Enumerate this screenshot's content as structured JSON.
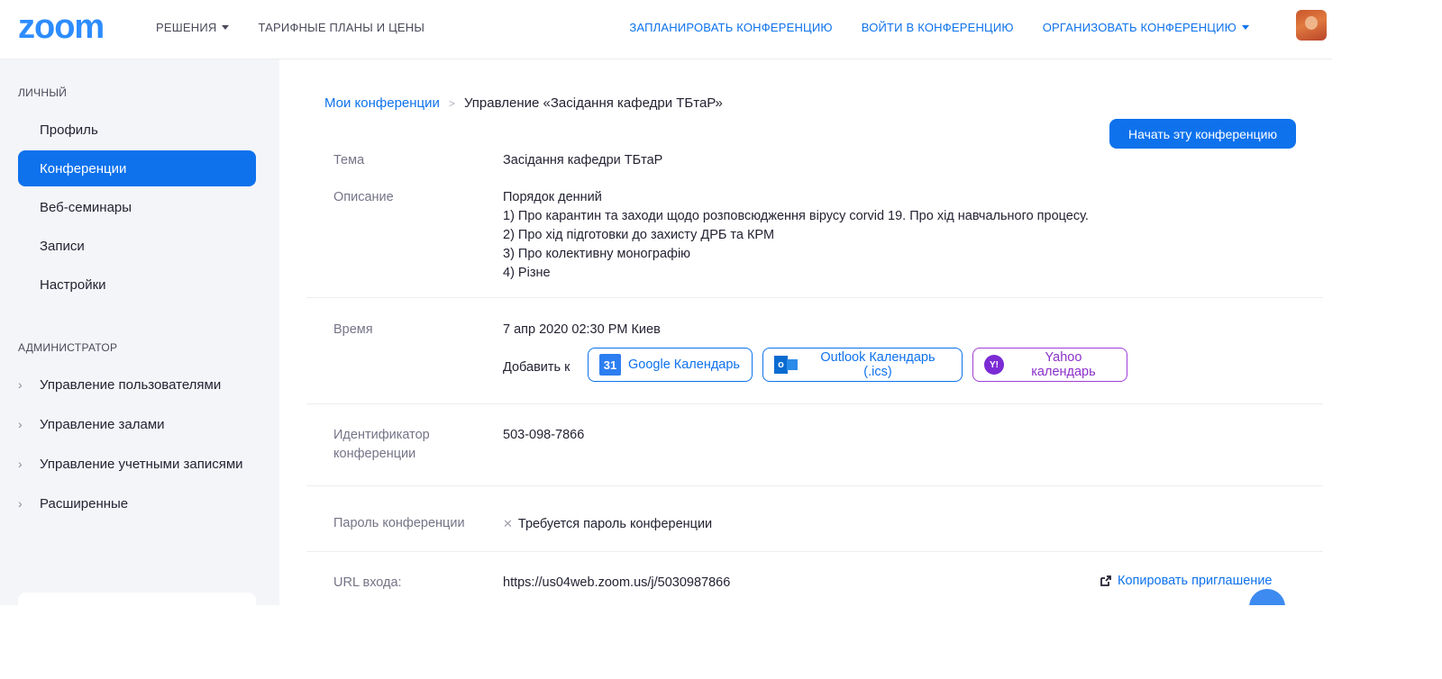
{
  "header": {
    "logo_text": "zoom",
    "nav_left": [
      "РЕШЕНИЯ",
      "ТАРИФНЫЕ ПЛАНЫ И ЦЕНЫ"
    ],
    "nav_right": [
      "ЗАПЛАНИРОВАТЬ КОНФЕРЕНЦИЮ",
      "ВОЙТИ В КОНФЕРЕНЦИЮ",
      "ОРГАНИЗОВАТЬ КОНФЕРЕНЦИЮ"
    ],
    "avatar_icon": "user-avatar"
  },
  "sidebar": {
    "personal_title": "ЛИЧНЫЙ",
    "personal_items": [
      "Профиль",
      "Конференции",
      "Веб-семинары",
      "Записи",
      "Настройки"
    ],
    "active_item": "Конференции",
    "admin_title": "АДМИНИСТРАТОР",
    "admin_items": [
      "Управление пользователями",
      "Управление залами",
      "Управление учетными записями",
      "Расширенные"
    ]
  },
  "breadcrumb": {
    "parent": "Мои конференции",
    "separator": ">",
    "current": "Управление «Засідання кафедри ТБтаР»"
  },
  "start_button": "Начать эту конференцию",
  "meeting": {
    "topic_label": "Тема",
    "topic": "Засідання кафедри ТБтаР",
    "description_label": "Описание",
    "description_lines": [
      "Порядок денний",
      "1) Про карантин та заходи щодо розповсюдження вірусу corvid 19. Про хід навчального процесу.",
      "2) Про хід підготовки до захисту ДРБ та КРМ",
      "3) Про колективну монографію",
      "4) Різне"
    ],
    "time_label": "Время",
    "time": "7 апр 2020 02:30 PM Киев",
    "add_to_label": "Добавить к",
    "calendars": {
      "google": "Google Календарь",
      "google_icon_text": "31",
      "outlook": "Outlook Календарь (.ics)",
      "outlook_icon_text": "o",
      "yahoo": "Yahoo календарь",
      "yahoo_icon_text": "Y!"
    },
    "id_label_line1": "Идентификатор",
    "id_label_line2": "конференции",
    "id": "503-098-7866",
    "password_label": "Пароль конференции",
    "password_value": "Требуется пароль конференции",
    "url_label": "URL входа:",
    "url": "https://us04web.zoom.us/j/5030987866",
    "copy_invite": "Копировать приглашение"
  },
  "colors": {
    "accent": "#0e72ed",
    "yahoo": "#8c2fc9",
    "sidebar_bg": "#f4f5f8"
  }
}
